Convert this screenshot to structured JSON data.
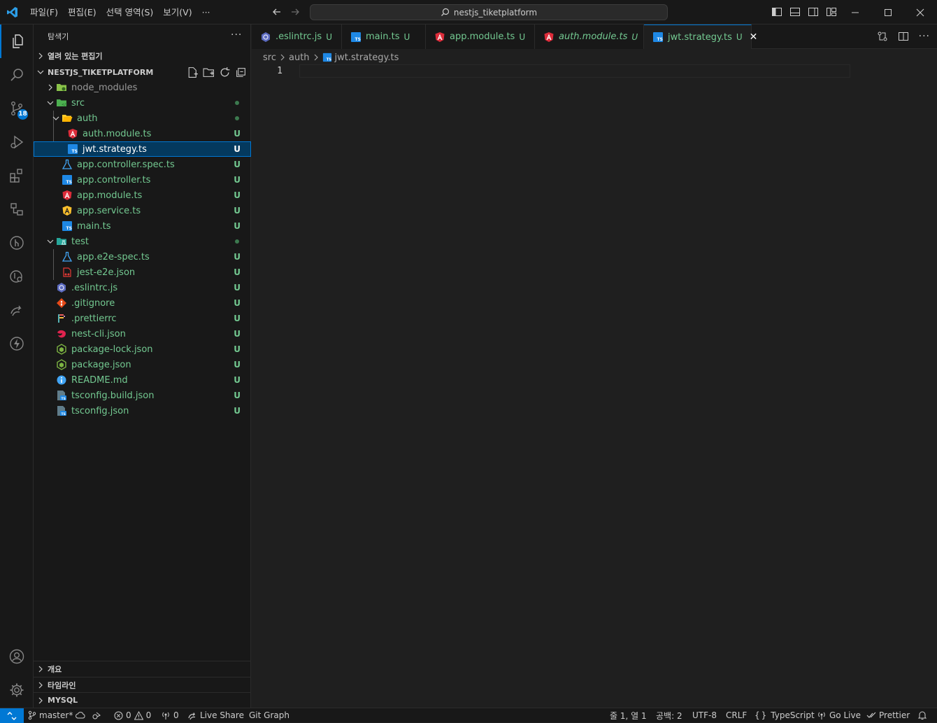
{
  "titlebar": {
    "menu": [
      "파일(F)",
      "편집(E)",
      "선택 영역(S)",
      "보기(V)",
      "···"
    ],
    "search_text": "nestjs_tiketplatform"
  },
  "activity": {
    "scm_badge": "18"
  },
  "sidebar": {
    "title": "탐색기",
    "more": "···",
    "open_editors": "열려 있는 편집기",
    "project": "NESTJS_TIKETPLATFORM",
    "items": [
      {
        "name": "node_modules",
        "status": ""
      },
      {
        "name": "src",
        "status": ""
      },
      {
        "name": "auth",
        "status": ""
      },
      {
        "name": "auth.module.ts",
        "status": "U"
      },
      {
        "name": "jwt.strategy.ts",
        "status": "U"
      },
      {
        "name": "app.controller.spec.ts",
        "status": "U"
      },
      {
        "name": "app.controller.ts",
        "status": "U"
      },
      {
        "name": "app.module.ts",
        "status": "U"
      },
      {
        "name": "app.service.ts",
        "status": "U"
      },
      {
        "name": "main.ts",
        "status": "U"
      },
      {
        "name": "test",
        "status": ""
      },
      {
        "name": "app.e2e-spec.ts",
        "status": "U"
      },
      {
        "name": "jest-e2e.json",
        "status": "U"
      },
      {
        "name": ".eslintrc.js",
        "status": "U"
      },
      {
        "name": ".gitignore",
        "status": "U"
      },
      {
        "name": ".prettierrc",
        "status": "U"
      },
      {
        "name": "nest-cli.json",
        "status": "U"
      },
      {
        "name": "package-lock.json",
        "status": "U"
      },
      {
        "name": "package.json",
        "status": "U"
      },
      {
        "name": "README.md",
        "status": "U"
      },
      {
        "name": "tsconfig.build.json",
        "status": "U"
      },
      {
        "name": "tsconfig.json",
        "status": "U"
      }
    ],
    "outline": "개요",
    "timeline": "타임라인",
    "mysql": "MYSQL"
  },
  "tabs": [
    {
      "label": ".eslintrc.js",
      "status": "U"
    },
    {
      "label": "main.ts",
      "status": "U"
    },
    {
      "label": "app.module.ts",
      "status": "U"
    },
    {
      "label": "auth.module.ts",
      "status": "U"
    },
    {
      "label": "jwt.strategy.ts",
      "status": "U",
      "close": "✕"
    }
  ],
  "breadcrumb": {
    "parts": [
      "src",
      "auth",
      "jwt.strategy.ts"
    ]
  },
  "editor": {
    "line_number": "1"
  },
  "statusbar": {
    "branch": "master*",
    "errors": "0",
    "warnings": "0",
    "ports": "0",
    "live_share": "Live Share",
    "git_graph": "Git Graph",
    "position": "줄 1, 열 1",
    "spaces": "공백: 2",
    "encoding": "UTF-8",
    "eol": "CRLF",
    "language_brace": "{}",
    "language": "TypeScript",
    "go_live": "Go Live",
    "prettier": "Prettier"
  },
  "colors": {
    "accent": "#0078d4",
    "untracked": "#73c991",
    "background": "#1f1f1f",
    "sidebar": "#181818"
  }
}
